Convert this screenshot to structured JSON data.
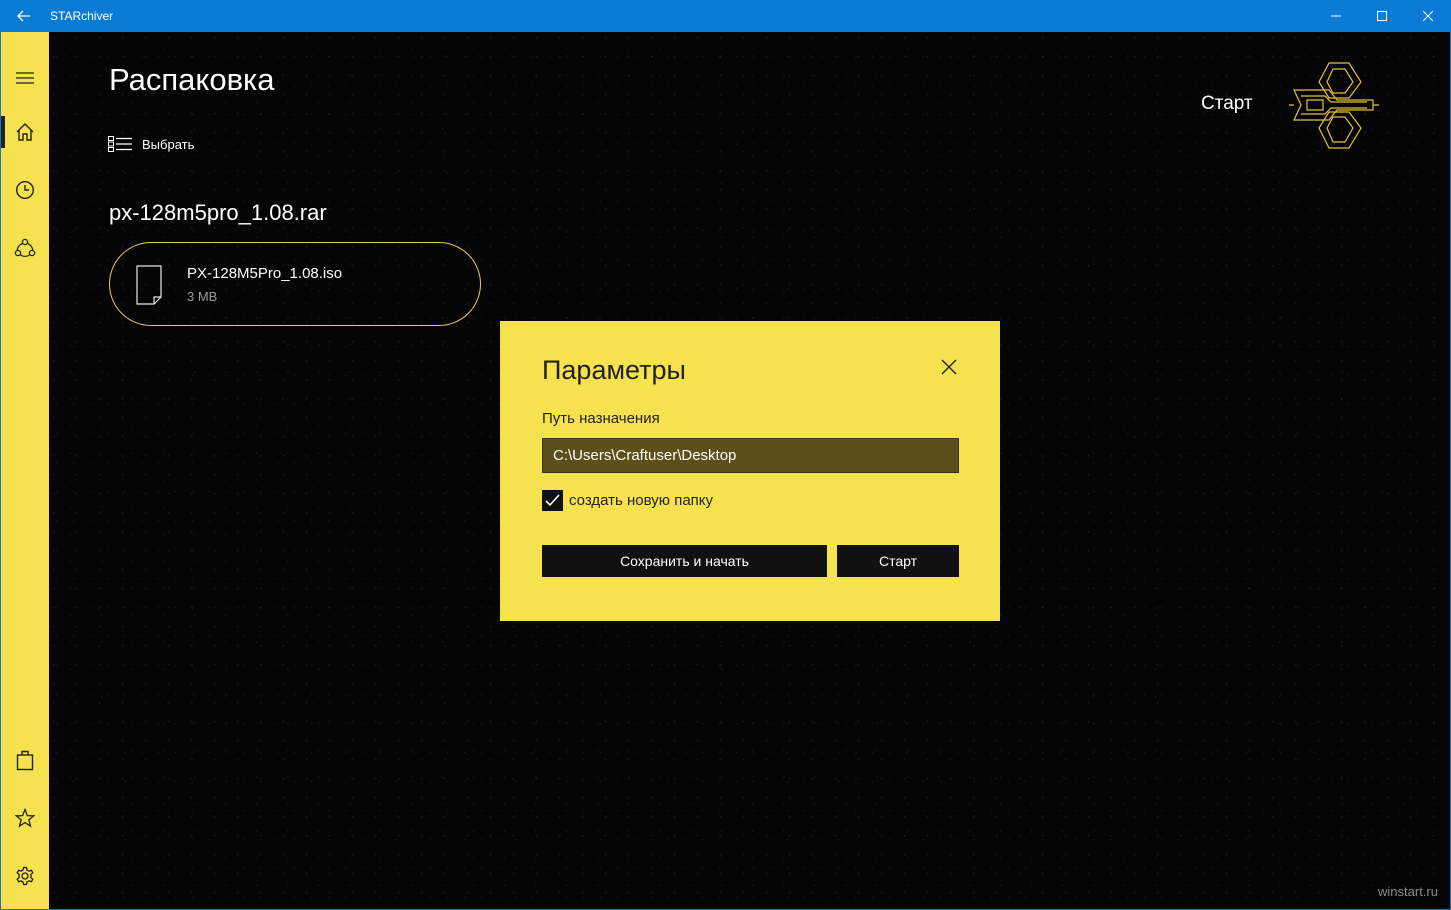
{
  "window": {
    "title": "STARchiver",
    "accent_color": "#0c7bd6",
    "theme_color": "#f6e24f"
  },
  "sidebar": {
    "items": [
      {
        "name": "menu",
        "icon": "hamburger-icon"
      },
      {
        "name": "home",
        "icon": "home-icon",
        "active": true
      },
      {
        "name": "history",
        "icon": "clock-icon"
      },
      {
        "name": "share",
        "icon": "share-icon"
      },
      {
        "name": "store",
        "icon": "shopping-bag-icon"
      },
      {
        "name": "favorites",
        "icon": "star-icon"
      },
      {
        "name": "settings",
        "icon": "gear-icon"
      }
    ]
  },
  "main": {
    "page_title": "Распаковка",
    "select_label": "Выбрать",
    "start_label": "Старт",
    "archive_name": "px-128m5pro_1.08.rar",
    "files": [
      {
        "name": "PX-128M5Pro_1.08.iso",
        "size": "3 MB"
      }
    ],
    "watermark": "winstart.ru"
  },
  "dialog": {
    "title": "Параметры",
    "dest_label": "Путь назначения",
    "dest_value": "C:\\Users\\Craftuser\\Desktop",
    "checkbox_label": "создать новую папку",
    "checkbox_checked": true,
    "save_button": "Сохранить и начать",
    "start_button": "Старт"
  }
}
